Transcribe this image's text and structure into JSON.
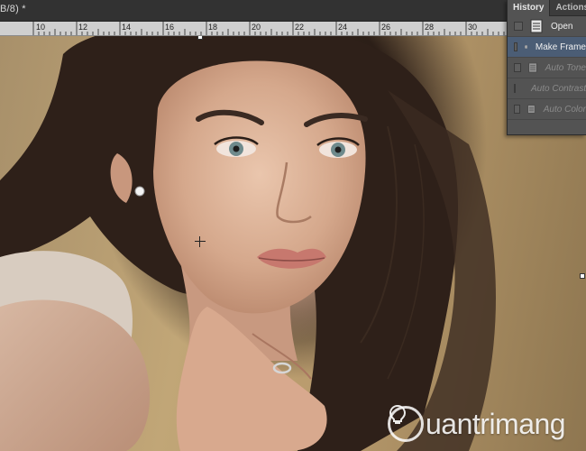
{
  "document": {
    "title": "B/8) *"
  },
  "ruler": {
    "ticks": [
      "10",
      "12",
      "14",
      "16",
      "18",
      "20",
      "22",
      "24",
      "26",
      "28",
      "30"
    ]
  },
  "history_panel": {
    "tabs": [
      {
        "label": "History",
        "active": true
      },
      {
        "label": "Actions",
        "active": false
      }
    ],
    "items": [
      {
        "label": "Open",
        "selected": false,
        "dimmed": false
      },
      {
        "label": "Make Frame",
        "selected": true,
        "dimmed": false
      },
      {
        "label": "Auto Tone",
        "selected": false,
        "dimmed": true
      },
      {
        "label": "Auto Contrast",
        "selected": false,
        "dimmed": true
      },
      {
        "label": "Auto Color",
        "selected": false,
        "dimmed": true
      }
    ]
  },
  "watermark": {
    "text": "uantrimang",
    "logo_icon": "lightbulb-icon"
  },
  "colors": {
    "panel_bg": "#535353",
    "selection": "#4b5d75",
    "ruler_bg": "#cfcfcf"
  }
}
